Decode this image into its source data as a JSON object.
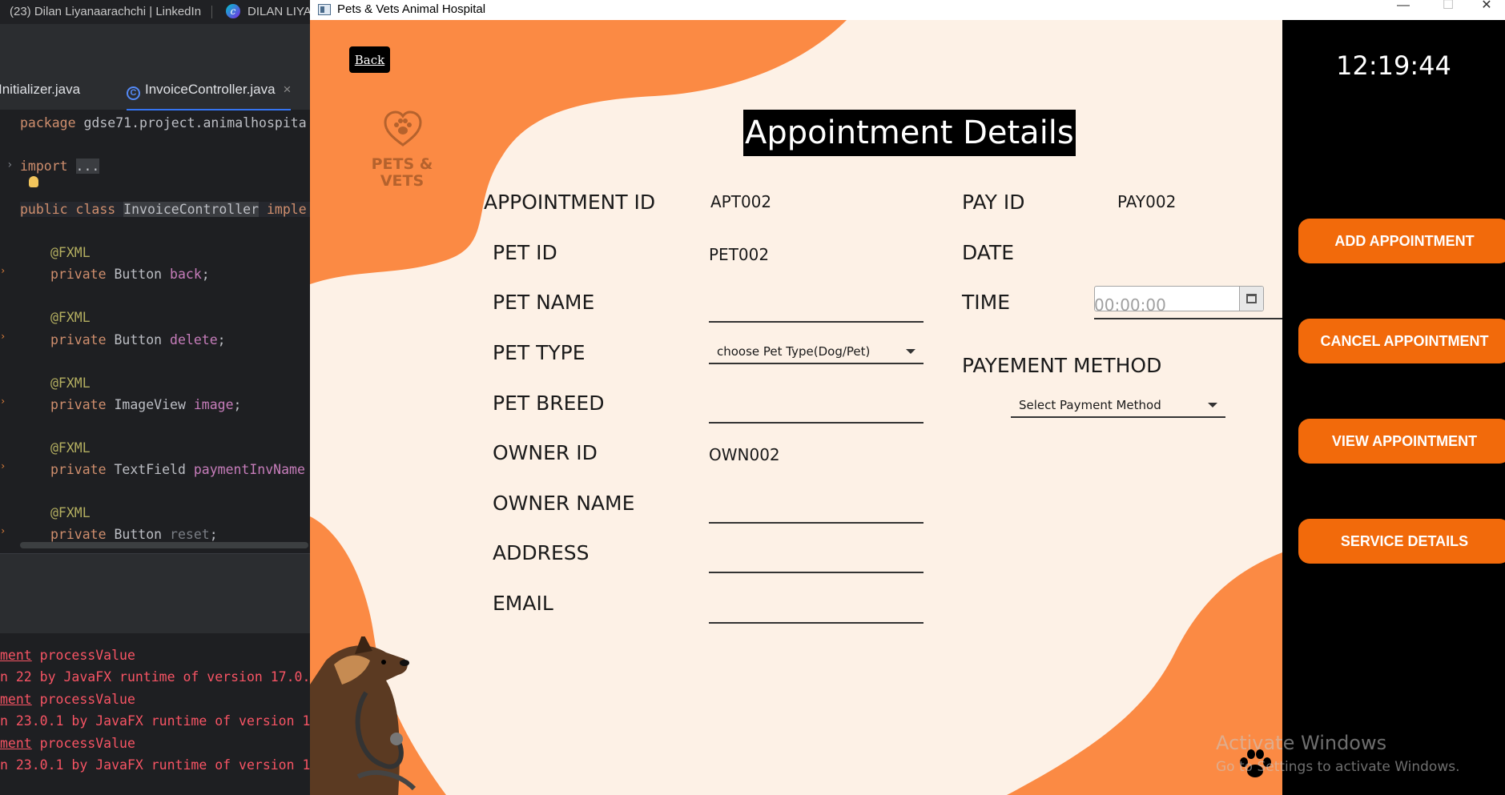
{
  "browser": {
    "tabs": [
      {
        "label": "(23) Dilan Liyanaarachchi | LinkedIn"
      },
      {
        "label": "DILAN LIYA"
      }
    ]
  },
  "ide": {
    "tabs": [
      {
        "label": "Initializer.java"
      },
      {
        "label": "InvoiceController.java",
        "close": "×"
      }
    ],
    "code": {
      "package_kw": "package",
      "package_name": " gdse71.project.animalhospita",
      "import_kw": "import",
      "import_fold": "...",
      "class_line": {
        "kw1": "public",
        "kw2": "class",
        "name": "InvoiceController",
        "rest": "imple"
      },
      "fields": [
        {
          "annotation": "@FXML",
          "modifier": "private",
          "type": "Button",
          "name": "back"
        },
        {
          "annotation": "@FXML",
          "modifier": "private",
          "type": "Button",
          "name": "delete"
        },
        {
          "annotation": "@FXML",
          "modifier": "private",
          "type": "ImageView",
          "name": "image"
        },
        {
          "annotation": "@FXML",
          "modifier": "private",
          "type": "TextField",
          "name": "paymentInvName"
        },
        {
          "annotation": "@FXML",
          "modifier": "private",
          "type": "Button",
          "name": "reset"
        }
      ]
    },
    "console_lines": [
      {
        "pre": "",
        "under": "ment",
        "post": " processValue"
      },
      {
        "pre": "n 22 by JavaFX runtime of version 17.0.",
        "under": "",
        "post": ""
      },
      {
        "pre": "",
        "under": "ment",
        "post": " processValue"
      },
      {
        "pre": "n 23.0.1 by JavaFX runtime of version 1",
        "under": "",
        "post": ""
      },
      {
        "pre": "",
        "under": "ment",
        "post": " processValue"
      },
      {
        "pre": "n 23.0.1 by JavaFX runtime of version 1",
        "under": "",
        "post": ""
      }
    ]
  },
  "window": {
    "title": "Pets & Vets Animal Hospital",
    "minimize": "—",
    "maximize": "☐",
    "close": "✕"
  },
  "app": {
    "back_label": "Back",
    "logo_text_line1": "PETS &",
    "logo_text_line2": "VETS",
    "page_title": "Appointment Details",
    "labels": {
      "appointment_id": "APPOINTMENT ID",
      "pet_id": "PET ID",
      "pet_name": "PET NAME",
      "pet_type": "PET TYPE",
      "pet_breed": "PET BREED",
      "owner_id": "OWNER ID",
      "owner_name": "OWNER NAME",
      "address": "ADDRESS",
      "email": "EMAIL",
      "pay_id": "PAY ID",
      "date": "DATE",
      "time": "TIME",
      "payment_method": "PAYEMENT METHOD"
    },
    "values": {
      "appointment_id": "APT002",
      "pet_id": "PET002",
      "owner_id": "OWN002",
      "pay_id": "PAY002",
      "pet_name": "",
      "pet_breed": "",
      "owner_name": "",
      "address": "",
      "email": "",
      "date": "",
      "time": ""
    },
    "placeholders": {
      "time": "00:00:00"
    },
    "pet_type_combo": "choose Pet Type(Dog/Pet)",
    "payment_combo": "Select Payment Method",
    "clock": "12:19:44",
    "side_buttons": [
      {
        "label": "ADD APPOINTMENT"
      },
      {
        "label": "CANCEL APPOINTMENT"
      },
      {
        "label": "VIEW APPOINTMENT"
      },
      {
        "label": "SERVICE DETAILS"
      }
    ],
    "colors": {
      "accent_orange": "#f26a0b",
      "blob_orange": "#fb8a44",
      "background_cream": "#fdf1e6",
      "sidebar_black": "#000000"
    }
  },
  "os_overlay": {
    "activate_title": "Activate Windows",
    "activate_sub": "Go to Settings to activate Windows."
  }
}
